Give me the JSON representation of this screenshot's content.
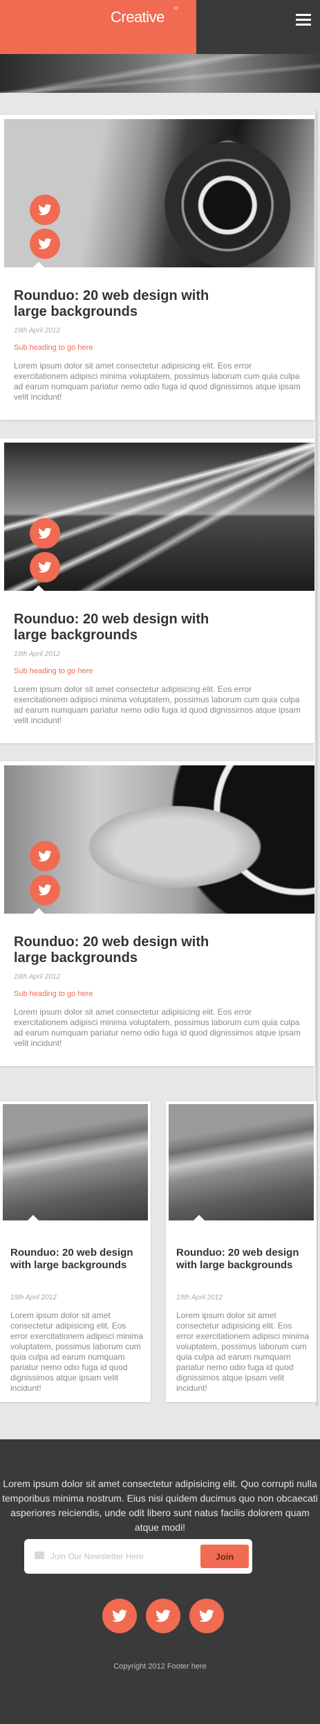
{
  "header": {
    "brand": "Creative",
    "brand_mark": "+",
    "menu_icon": "hamburger-menu-icon"
  },
  "colors": {
    "accent": "#f06b52",
    "header_bg": "#3a3a3a",
    "page_bg": "#e7e7e7",
    "footer_bg": "#3a3a3a"
  },
  "posts": [
    {
      "title": "Rounduo: 20 web design with large backgrounds",
      "date": "19th April 2012",
      "subheading": "Sub heading to go here",
      "body": "Lorem ipsum dolor sit amet consectetur adipisicing elit. Eos error exercitationem adipisci minima voluptatem, possimus laborum cum quia culpa ad earum numquam pariatur nemo odio fuga id quod dignissimos atque ipsam velit incidunt!",
      "image": "vintage-camera-photo"
    },
    {
      "title": "Rounduo: 20 web design with large backgrounds",
      "date": "19th April 2012",
      "subheading": "Sub heading to go here",
      "body": "Lorem ipsum dolor sit amet consectetur adipisicing elit. Eos error exercitationem adipisci minima voluptatem, possimus laborum cum quia culpa ad earum numquam pariatur nemo odio fuga id quod dignissimos atque ipsam velit incidunt!",
      "image": "highway-light-trails-photo"
    },
    {
      "title": "Rounduo: 20 web design with large backgrounds",
      "date": "19th April 2012",
      "subheading": "Sub heading to go here",
      "body": "Lorem ipsum dolor sit amet consectetur adipisicing elit. Eos error exercitationem adipisci minima voluptatem, possimus laborum cum quia culpa ad earum numquam pariatur nemo odio fuga id quod dignissimos atque ipsam velit incidunt!",
      "image": "camera-dial-finger-photo"
    }
  ],
  "small_posts": [
    {
      "title": "Rounduo: 20 web design with large backgrounds",
      "date": "19th April 2012",
      "body": "Lorem ipsum dolor sit amet consectetur adipisicing elit. Eos error exercitationem adipisci minima voluptatem, possimus laborum cum quia culpa ad earum numquam pariatur nemo odio fuga id quod dignissimos atque ipsam velit incidunt!",
      "image": "coastline-aerial-photo"
    },
    {
      "title": "Rounduo: 20 web design with large backgrounds",
      "date": "19th April 2012",
      "body": "Lorem ipsum dolor sit amet consectetur adipisicing elit. Eos error exercitationem adipisci minima voluptatem, possimus laborum cum quia culpa ad earum numquam pariatur nemo odio fuga id quod dignissimos atque ipsam velit incidunt!",
      "image": "coastline-aerial-photo"
    }
  ],
  "footer": {
    "text": "Lorem ipsum dolor sit amet consectetur adipisicing elit. Quo corrupti nulla temporibus minima nostrum. Eius nisi quidem ducimus quo non obcaecati asperiores reiciendis, unde odit libero sunt natus facilis dolorem quam atque modi!",
    "newsletter_placeholder": "Join Our Newsletter Here",
    "newsletter_button": "Join",
    "social_icons": [
      "twitter-icon",
      "twitter-icon",
      "twitter-icon"
    ],
    "copyright": "Copyright 2012 Footer here"
  }
}
